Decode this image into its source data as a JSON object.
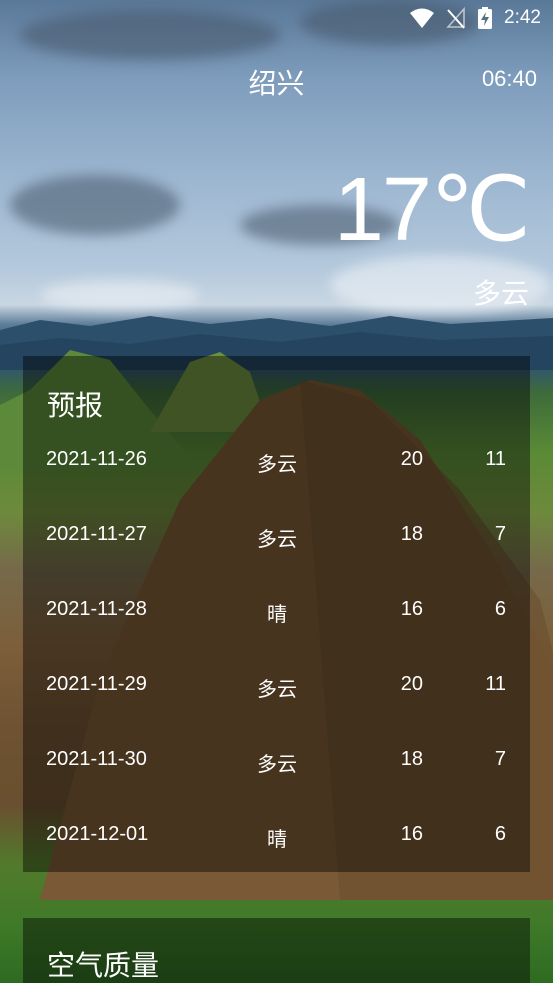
{
  "status_bar": {
    "time": "2:42",
    "icons": [
      "wifi-icon",
      "no-signal-icon",
      "battery-charging-icon"
    ]
  },
  "header": {
    "city": "绍兴",
    "update_time": "06:40"
  },
  "now": {
    "temperature": "17℃",
    "condition": "多云"
  },
  "forecast": {
    "title": "预报",
    "rows": [
      {
        "date": "2021-11-26",
        "condition": "多云",
        "max": "20",
        "min": "11"
      },
      {
        "date": "2021-11-27",
        "condition": "多云",
        "max": "18",
        "min": "7"
      },
      {
        "date": "2021-11-28",
        "condition": "晴",
        "max": "16",
        "min": "6"
      },
      {
        "date": "2021-11-29",
        "condition": "多云",
        "max": "20",
        "min": "11"
      },
      {
        "date": "2021-11-30",
        "condition": "多云",
        "max": "18",
        "min": "7"
      },
      {
        "date": "2021-12-01",
        "condition": "晴",
        "max": "16",
        "min": "6"
      }
    ]
  },
  "aqi": {
    "title": "空气质量"
  },
  "colors": {
    "text": "#ffffff",
    "card_overlay": "rgba(0,0,0,0.42)"
  }
}
